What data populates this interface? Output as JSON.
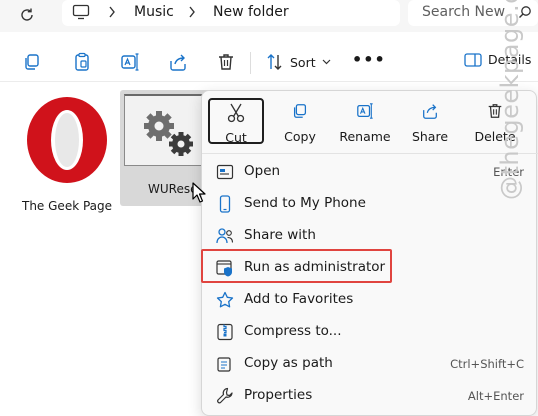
{
  "address_bar": {
    "crumbs": [
      "Music",
      "New folder"
    ],
    "search_placeholder": "Search New"
  },
  "toolbar": {
    "sort_label": "Sort",
    "details_label": "Details"
  },
  "files": [
    {
      "name": "The Geek Page",
      "icon": "opera-icon"
    },
    {
      "name": "WURese",
      "icon": "gear-file-icon"
    }
  ],
  "context_menu": {
    "quick_actions": [
      {
        "label": "Cut",
        "icon": "scissors-icon"
      },
      {
        "label": "Copy",
        "icon": "copy-icon"
      },
      {
        "label": "Rename",
        "icon": "rename-icon"
      },
      {
        "label": "Share",
        "icon": "share-icon"
      },
      {
        "label": "Delete",
        "icon": "trash-icon"
      }
    ],
    "items": [
      {
        "label": "Open",
        "shortcut": "Enter",
        "icon": "open-app-icon"
      },
      {
        "label": "Send to My Phone",
        "shortcut": "",
        "icon": "phone-icon"
      },
      {
        "label": "Share with",
        "shortcut": "",
        "icon": "share-with-icon"
      },
      {
        "label": "Run as administrator",
        "shortcut": "",
        "icon": "shield-icon"
      },
      {
        "label": "Add to Favorites",
        "shortcut": "",
        "icon": "star-icon"
      },
      {
        "label": "Compress to...",
        "shortcut": "",
        "icon": "zip-icon"
      },
      {
        "label": "Copy as path",
        "shortcut": "Ctrl+Shift+C",
        "icon": "copy-path-icon"
      },
      {
        "label": "Properties",
        "shortcut": "Alt+Enter",
        "icon": "wrench-icon"
      }
    ]
  },
  "watermark": "@thegeekpage.com",
  "colors": {
    "accent": "#1a73c9",
    "highlight": "#e0443f",
    "opera_red": "#d0121b"
  }
}
